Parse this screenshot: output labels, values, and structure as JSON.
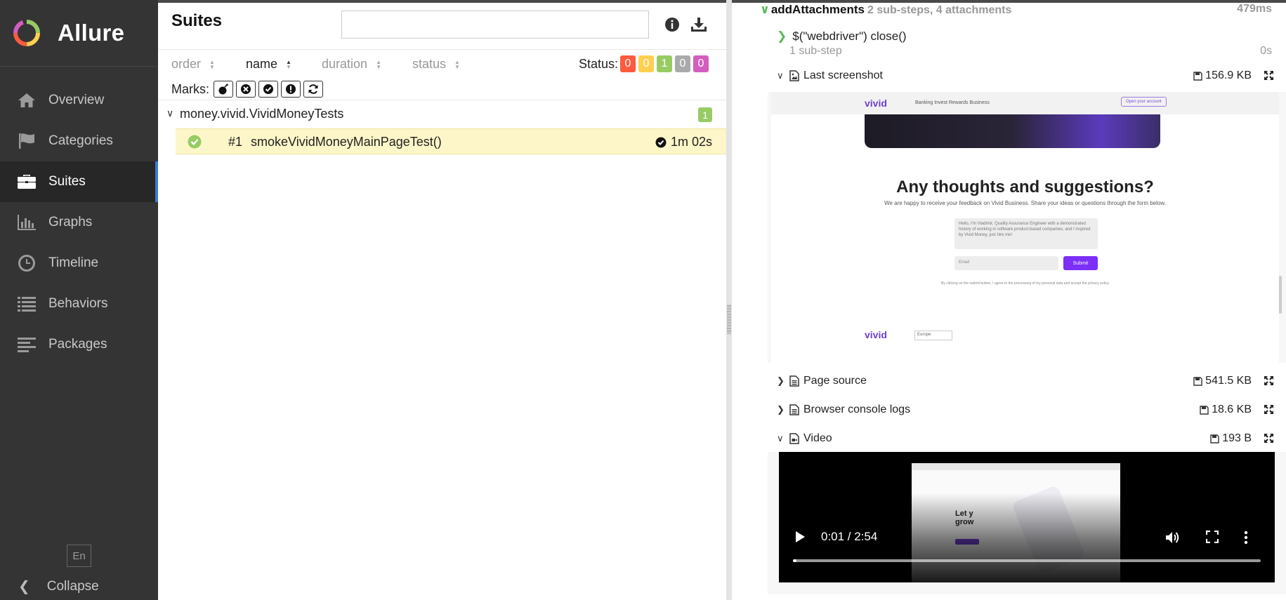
{
  "brand": {
    "name": "Allure"
  },
  "sidebar": {
    "items": [
      {
        "label": "Overview",
        "icon": "home-icon"
      },
      {
        "label": "Categories",
        "icon": "flag-icon"
      },
      {
        "label": "Suites",
        "icon": "briefcase-icon",
        "active": true
      },
      {
        "label": "Graphs",
        "icon": "bar-chart-icon"
      },
      {
        "label": "Timeline",
        "icon": "clock-icon"
      },
      {
        "label": "Behaviors",
        "icon": "list-icon"
      },
      {
        "label": "Packages",
        "icon": "align-left-icon"
      }
    ],
    "lang": "En",
    "collapse_label": "Collapse"
  },
  "left": {
    "title": "Suites",
    "search_placeholder": "",
    "sort": {
      "order": "order",
      "name": "name",
      "duration": "duration",
      "status": "status"
    },
    "status_label": "Status:",
    "status_counts": [
      {
        "value": "0",
        "color": "#fd5a3e"
      },
      {
        "value": "0",
        "color": "#ffd050"
      },
      {
        "value": "1",
        "color": "#97cc64"
      },
      {
        "value": "0",
        "color": "#aaaaaa"
      },
      {
        "value": "0",
        "color": "#d35ebe"
      }
    ],
    "marks_label": "Marks:",
    "group": {
      "name": "money.vivid.VividMoneyTests",
      "count": "1"
    },
    "test": {
      "number": "#1",
      "name": "smokeVividMoneyMainPageTest()",
      "duration": "1m 02s"
    }
  },
  "right": {
    "step": {
      "name": "addAttachments",
      "summary": "2 sub-steps, 4 attachments",
      "time": "479ms"
    },
    "substep": {
      "name": "$(\"webdriver\") close()",
      "info": "1 sub-step",
      "time": "0s"
    },
    "attachments": {
      "screenshot": {
        "name": "Last screenshot",
        "size": "156.9 KB"
      },
      "page_source": {
        "name": "Page source",
        "size": "541.5 KB"
      },
      "console_logs": {
        "name": "Browser console logs",
        "size": "18.6 KB"
      },
      "video": {
        "name": "Video",
        "size": "193 B"
      }
    },
    "screenshot_content": {
      "logo": "vivid",
      "nav_links": "Banking  Invest  Rewards  Business",
      "cta": "Open your account",
      "heading": "Any thoughts and suggestions?",
      "subheading": "We are happy to receive your feedback on Vivid Business. Share your ideas or questions through the form below.",
      "textarea": "Hello, I'm Vladimir, Quality Assurance Engineer with a demonstrated history of working in software product-based companies, and I inspired by Vivid Money, just hire me!",
      "email_placeholder": "Email",
      "submit": "Submit",
      "consent": "By clicking on the submit button, I agree to the processing of my personal data and accept the privacy policy",
      "footer_logo": "vivid",
      "region": "Europe"
    },
    "video_player": {
      "time": "0:01 / 2:54",
      "progress": 0.006
    }
  }
}
